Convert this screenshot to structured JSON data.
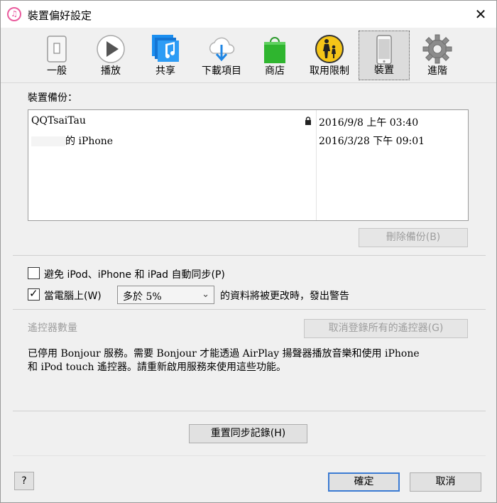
{
  "window": {
    "title": "裝置偏好設定",
    "app_icon": "itunes-note-icon",
    "close_glyph": "✕"
  },
  "toolbar": {
    "items": [
      {
        "label": "一般",
        "icon": "general-switch-icon"
      },
      {
        "label": "播放",
        "icon": "play-icon"
      },
      {
        "label": "共享",
        "icon": "sharing-music-icon"
      },
      {
        "label": "下載項目",
        "icon": "cloud-download-icon"
      },
      {
        "label": "商店",
        "icon": "store-bag-icon"
      },
      {
        "label": "取用限制",
        "icon": "parental-controls-icon"
      },
      {
        "label": "裝置",
        "icon": "iphone-device-icon",
        "active": true
      },
      {
        "label": "進階",
        "icon": "gear-icon"
      }
    ]
  },
  "backups": {
    "label": "裝置備份：",
    "rows": [
      {
        "name": "QQTsaiTau",
        "date": "2016/9/8 上午 03:40",
        "locked": true
      },
      {
        "name_suffix": "的 iPhone",
        "date": "2016/3/28 下午 09:01",
        "locked": false
      }
    ],
    "delete_button": "刪除備份(B)"
  },
  "sync": {
    "prevent_auto_sync": "避免 iPod、iPhone 和 iPad 自動同步(P)",
    "prevent_auto_sync_checked": false,
    "warn_prefix": "當電腦上(W)",
    "warn_checked": true,
    "warn_select_value": "多於 5%",
    "warn_suffix": "的資料將被更改時，發出警告"
  },
  "remotes": {
    "label": "遙控器數量",
    "forget_button": "取消登錄所有的遙控器(G)",
    "bonjour_line1": "已停用 Bonjour 服務。需要 Bonjour 才能透過 AirPlay 揚聲器播放音樂和使用 iPhone",
    "bonjour_line2": "和 iPod touch 遙控器。請重新啟用服務來使用這些功能。"
  },
  "reset_button": "重置同步記錄(H)",
  "footer": {
    "help": "?",
    "ok": "確定",
    "cancel": "取消"
  },
  "colors": {
    "accent_border": "#3b7bd3",
    "window_bg": "#f0f0f0"
  }
}
